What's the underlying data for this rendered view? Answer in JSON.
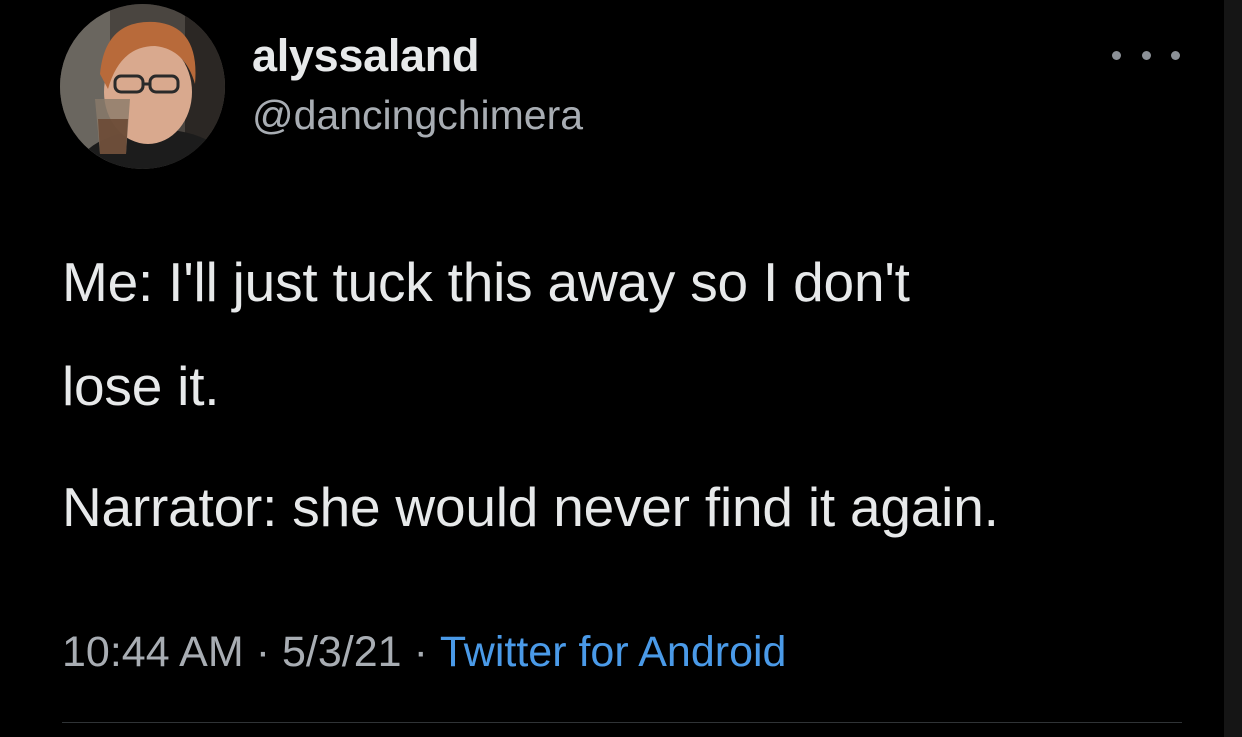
{
  "user": {
    "display_name": "alyssaland",
    "handle": "@dancingchimera"
  },
  "tweet": {
    "line1": "Me: I'll just tuck this away so I don't",
    "line2": "lose it.",
    "line3": "Narrator: she would never find it again."
  },
  "meta": {
    "time": "10:44 AM",
    "separator": "·",
    "date": "5/3/21",
    "source": "Twitter for Android"
  },
  "icons": {
    "more": "more-options-icon",
    "avatar": "profile-photo"
  },
  "colors": {
    "background": "#000000",
    "text": "#e7e9ea",
    "muted": "#a8adb3",
    "link": "#4a9ae8"
  }
}
